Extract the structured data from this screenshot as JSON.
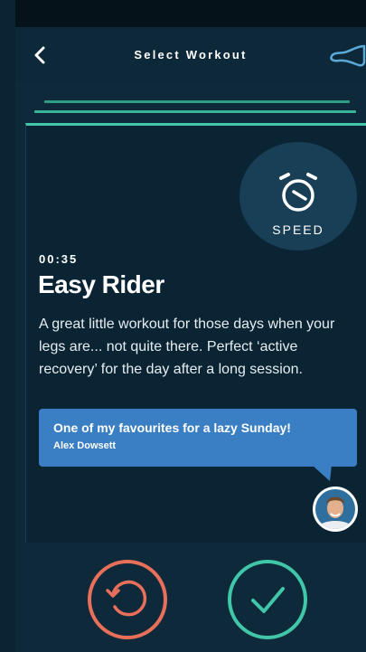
{
  "header": {
    "title": "Select Workout"
  },
  "workout": {
    "category": "SPEED",
    "duration": "00:35",
    "title": "Easy Rider",
    "description": "A great little workout for those days when your legs are... not quite there. Perfect ‘active recovery’ for the day after a long session."
  },
  "comment": {
    "quote": "One of my favourites for a lazy Sunday!",
    "author": "Alex Dowsett"
  },
  "colors": {
    "accent_green": "#3fc7a8",
    "accent_coral": "#e8705a",
    "bubble_blue": "#3a7fc4",
    "card_bg": "#0b2434"
  },
  "icons": {
    "back": "chevron-left-icon",
    "bike": "bike-saddle-icon",
    "speed": "stopwatch-icon",
    "reset": "restart-icon",
    "confirm": "check-icon"
  }
}
